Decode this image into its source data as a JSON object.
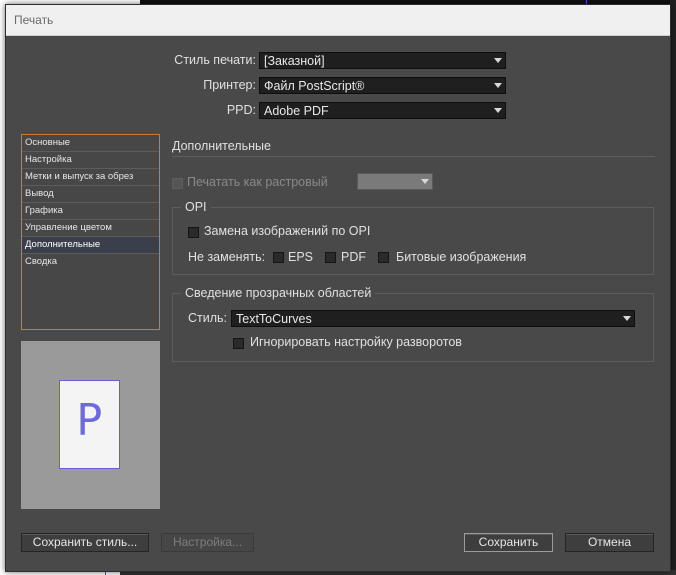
{
  "window": {
    "title": "Печать"
  },
  "top": {
    "style_label": "Стиль печати:",
    "style_value": "[Заказной]",
    "printer_label": "Принтер:",
    "printer_value": "Файл PostScript®",
    "ppd_label": "PPD:",
    "ppd_value": "Adobe PDF"
  },
  "sidebar": {
    "items": [
      {
        "label": "Основные",
        "selected": false
      },
      {
        "label": "Настройка",
        "selected": false
      },
      {
        "label": "Метки и выпуск за обрез",
        "selected": false
      },
      {
        "label": "Вывод",
        "selected": false
      },
      {
        "label": "Графика",
        "selected": false
      },
      {
        "label": "Управление цветом",
        "selected": false
      },
      {
        "label": "Дополнительные",
        "selected": true
      },
      {
        "label": "Сводка",
        "selected": false
      }
    ]
  },
  "preview": {
    "letter": "P"
  },
  "section": {
    "title": "Дополнительные"
  },
  "raster": {
    "label": "Печатать как растровый",
    "checked": false,
    "enabled": false
  },
  "opi": {
    "title": "OPI",
    "replace_label": "Замена изображений по OPI",
    "dont_replace_label": "Не заменять:",
    "eps_label": "EPS",
    "pdf_label": "PDF",
    "bitmap_label": "Битовые изображения"
  },
  "flattener": {
    "title": "Сведение прозрачных областей",
    "style_label": "Стиль:",
    "style_value": "TextToCurves",
    "ignore_label": "Игнорировать настройку разворотов"
  },
  "buttons": {
    "save_style": "Сохранить стиль...",
    "setup": "Настройка...",
    "save": "Сохранить",
    "cancel": "Отмена"
  },
  "colors": {
    "dialog_bg": "#494949",
    "accent_border": "#d27a2b",
    "selection": "#3a3f4b",
    "preview_glyph": "#6f6ad8"
  }
}
